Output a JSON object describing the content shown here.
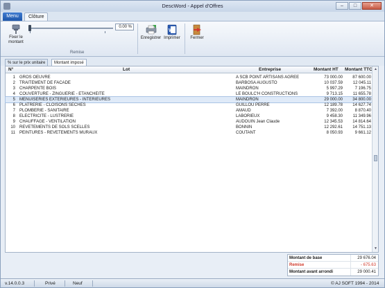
{
  "window": {
    "title": "DescWord - Appel d'Offres",
    "buttons": {
      "minimize": "–",
      "maximize": "□",
      "close": "✕"
    }
  },
  "ribbon": {
    "tabs": [
      "Menu",
      "Clôture"
    ],
    "fix_label_1": "Fixer le",
    "fix_label_2": "montant",
    "percent_value": "0.00 %",
    "group_label": "Remise",
    "save_label": "Enregistrer",
    "print_label": "Imprimer",
    "close_label": "Fermer"
  },
  "doc_tabs": [
    "% sur le prix unitaire",
    "Montant imposé"
  ],
  "table": {
    "headers": {
      "num": "N°",
      "lot": "Lot",
      "entreprise": "Entreprise",
      "ht": "Montant HT",
      "ttc": "Montant TTC"
    },
    "rows": [
      {
        "n": "1",
        "lot": "GROS OEUVRE",
        "ent": "A SCB POINT ARTISANS AGREE",
        "ht": "73 000.00",
        "ttc": "87 600.00"
      },
      {
        "n": "2",
        "lot": "TRAITEMENT DE FACADE",
        "ent": "BARBOSA AUGUSTO",
        "ht": "10 037.59",
        "ttc": "12 045.11"
      },
      {
        "n": "3",
        "lot": "CHARPENTE BOIS",
        "ent": "MAINDRON",
        "ht": "5 997.29",
        "ttc": "7 196.75"
      },
      {
        "n": "4",
        "lot": "COUVERTURE - ZINGUERIE - ETANCHEITE",
        "ent": "LE BOULC'H CONSTRUCTIONS",
        "ht": "9 713.15",
        "ttc": "11 655.78"
      },
      {
        "n": "5",
        "lot": "MENUISERIES EXTERIEURES - INTERIEURES",
        "ent": "MAINDRON",
        "ht": "29 000.00",
        "ttc": "34 800.00"
      },
      {
        "n": "6",
        "lot": "PLATRERIE - CLOISONS SECHES",
        "ent": "GUILLOU PERRE",
        "ht": "12 189.78",
        "ttc": "14 627.74"
      },
      {
        "n": "7",
        "lot": "PLOMBERIE - SANITAIRE",
        "ent": "AMAUD",
        "ht": "7 392.00",
        "ttc": "8 870.40"
      },
      {
        "n": "8",
        "lot": "ELECTRICITE - LUSTRERIE",
        "ent": "LABORIEUX",
        "ht": "9 458.30",
        "ttc": "11 349.96"
      },
      {
        "n": "9",
        "lot": "CHAUFFAGE - VENTILATION",
        "ent": "AUDOUIN Jean Claude",
        "ht": "12 345.53",
        "ttc": "14 814.64"
      },
      {
        "n": "10",
        "lot": "REVETEMENTS DE SOLS SCELLES",
        "ent": "BONNIN",
        "ht": "12 292.61",
        "ttc": "14 751.13"
      },
      {
        "n": "11",
        "lot": "PEINTURES - REVETEMENTS MURAUX",
        "ent": "COUTANT",
        "ht": "8 050.93",
        "ttc": "9 661.12"
      }
    ]
  },
  "totals": {
    "base_label": "Montant de base",
    "base_value": "29 676.04",
    "remise_label": "Remise",
    "remise_value": "- 675.63",
    "avant_label": "Montant avant arrondi",
    "avant_value": "29 000.41"
  },
  "status": {
    "version": "v.14.0.0.3",
    "mode": "Privé",
    "state": "Neuf",
    "copyright": "© AJ SOFT 1994 - 2014"
  },
  "colors": {
    "accent": "#1e56aa",
    "remise": "#d0392b"
  }
}
